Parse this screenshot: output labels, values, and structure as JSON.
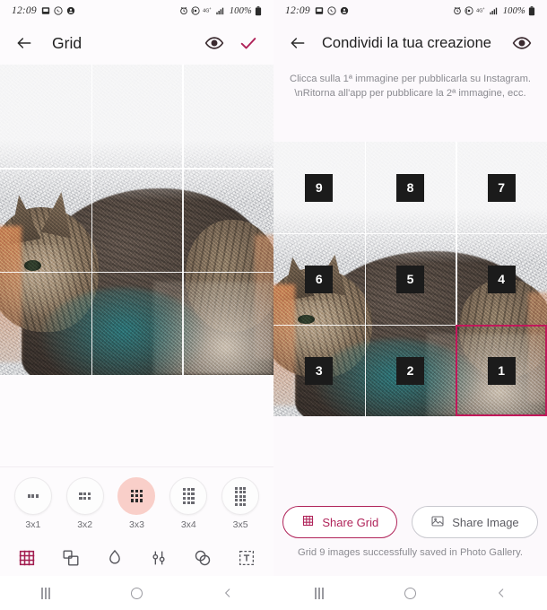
{
  "status_bar": {
    "time": "12:09",
    "left_icons": [
      "screenshot-icon",
      "whatsapp-icon",
      "app-icon"
    ],
    "right_icons": [
      "alarm-icon",
      "wifi-hotspot-icon",
      "nfc-icon",
      "signal-icon"
    ],
    "battery": "100%"
  },
  "colors": {
    "accent": "#b0245a",
    "accent_soft": "#f9cfc9",
    "selection_border": "#c2185b",
    "muted_text": "#8b8b91",
    "badge_bg": "#1b1b1b"
  },
  "left_screen": {
    "appbar": {
      "back_icon": "arrow-left-icon",
      "title": "Grid",
      "actions": [
        {
          "name": "preview-eye-icon",
          "label": "Preview"
        },
        {
          "name": "confirm-check-icon",
          "label": "Confirm"
        }
      ]
    },
    "grid_preview": {
      "rows": 3,
      "columns": 3
    },
    "size_options": [
      {
        "label": "3x1",
        "cols": 3,
        "rows": 1,
        "active": false
      },
      {
        "label": "3x2",
        "cols": 3,
        "rows": 2,
        "active": false
      },
      {
        "label": "3x3",
        "cols": 3,
        "rows": 3,
        "active": true
      },
      {
        "label": "3x4",
        "cols": 3,
        "rows": 4,
        "active": false
      },
      {
        "label": "3x5",
        "cols": 3,
        "rows": 5,
        "active": false
      }
    ],
    "tools": [
      {
        "name": "grid-tool-icon",
        "label": "Grid",
        "active": true
      },
      {
        "name": "layers-tool-icon",
        "label": "Layers",
        "active": false
      },
      {
        "name": "blur-drop-tool-icon",
        "label": "Blur",
        "active": false
      },
      {
        "name": "adjust-sliders-tool-icon",
        "label": "Adjust",
        "active": false
      },
      {
        "name": "blend-circles-tool-icon",
        "label": "Blend",
        "active": false
      },
      {
        "name": "text-tool-icon",
        "label": "Text",
        "active": false
      }
    ]
  },
  "right_screen": {
    "appbar": {
      "back_icon": "arrow-left-icon",
      "title": "Condividi la tua creazione",
      "actions": [
        {
          "name": "preview-eye-icon",
          "label": "Preview"
        }
      ]
    },
    "hint_line1": "Clicca sulla 1ª immagine per pubblicarla su Instagram.",
    "hint_line2": "\\nRitorna all'app per pubblicare la 2ª immagine, ecc.",
    "cells": [
      {
        "number": "9",
        "selected": false
      },
      {
        "number": "8",
        "selected": false
      },
      {
        "number": "7",
        "selected": false
      },
      {
        "number": "6",
        "selected": false
      },
      {
        "number": "5",
        "selected": false
      },
      {
        "number": "4",
        "selected": false
      },
      {
        "number": "3",
        "selected": false
      },
      {
        "number": "2",
        "selected": false
      },
      {
        "number": "1",
        "selected": true
      }
    ],
    "share_grid_label": "Share Grid",
    "share_image_label": "Share Image",
    "saved_note": "Grid 9 images successfully saved in Photo Gallery."
  },
  "navbar": {
    "recents_label": "Recents",
    "home_label": "Home",
    "back_label": "Back"
  }
}
